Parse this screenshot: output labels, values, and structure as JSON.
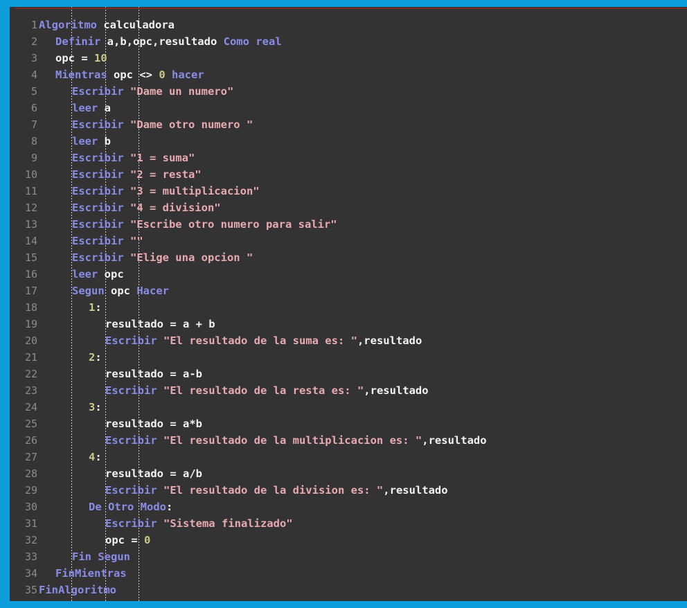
{
  "window": {
    "title": "PSeInt pseudocode editor",
    "frame_color": "#0D9DDB",
    "code_background": "#333333",
    "top_rule_color": "#7E2A2A"
  },
  "palette": {
    "keyword": "#8C8CE8",
    "string": "#E8A9B4",
    "number": "#C9C98A",
    "identifier": "#F2F2F2",
    "gutter": "#8C8C8C",
    "indent_guide": "#C9C9C9"
  },
  "gutter": {
    "line_numbers": [
      "1",
      "2",
      "3",
      "4",
      "5",
      "6",
      "7",
      "8",
      "9",
      "10",
      "11",
      "12",
      "13",
      "14",
      "15",
      "16",
      "17",
      "18",
      "19",
      "20",
      "21",
      "22",
      "23",
      "24",
      "25",
      "26",
      "27",
      "28",
      "29",
      "30",
      "31",
      "32",
      "33",
      "34",
      "35"
    ]
  },
  "indent_guides": [
    103,
    152,
    200
  ],
  "code": {
    "language": "PSeInt",
    "algorithm_name": "calculadora",
    "lines": [
      {
        "n": "1",
        "indent": 0,
        "tokens": [
          {
            "t": "kw",
            "v": "Algoritmo"
          },
          {
            "t": "id",
            "v": " calculadora"
          }
        ]
      },
      {
        "n": "2",
        "indent": 1,
        "tokens": [
          {
            "t": "kw",
            "v": "Definir"
          },
          {
            "t": "id",
            "v": " a,b,opc,resultado "
          },
          {
            "t": "kw",
            "v": "Como real"
          }
        ]
      },
      {
        "n": "3",
        "indent": 1,
        "tokens": [
          {
            "t": "id",
            "v": "opc = "
          },
          {
            "t": "num",
            "v": "10"
          }
        ]
      },
      {
        "n": "4",
        "indent": 1,
        "tokens": [
          {
            "t": "kw",
            "v": "Mientras"
          },
          {
            "t": "id",
            "v": " opc <> "
          },
          {
            "t": "num",
            "v": "0"
          },
          {
            "t": "kw",
            "v": " hacer"
          }
        ]
      },
      {
        "n": "5",
        "indent": 2,
        "tokens": [
          {
            "t": "kw",
            "v": "Escribir"
          },
          {
            "t": "str",
            "v": " \"Dame un numero\""
          }
        ]
      },
      {
        "n": "6",
        "indent": 2,
        "tokens": [
          {
            "t": "kw",
            "v": "leer"
          },
          {
            "t": "id",
            "v": " a"
          }
        ]
      },
      {
        "n": "7",
        "indent": 2,
        "tokens": [
          {
            "t": "kw",
            "v": "Escribir"
          },
          {
            "t": "str",
            "v": " \"Dame otro numero \""
          }
        ]
      },
      {
        "n": "8",
        "indent": 2,
        "tokens": [
          {
            "t": "kw",
            "v": "leer"
          },
          {
            "t": "id",
            "v": " b"
          }
        ]
      },
      {
        "n": "9",
        "indent": 2,
        "tokens": [
          {
            "t": "kw",
            "v": "Escribir"
          },
          {
            "t": "str",
            "v": " \"1 = suma\""
          }
        ]
      },
      {
        "n": "10",
        "indent": 2,
        "tokens": [
          {
            "t": "kw",
            "v": "Escribir"
          },
          {
            "t": "str",
            "v": " \"2 = resta\""
          }
        ]
      },
      {
        "n": "11",
        "indent": 2,
        "tokens": [
          {
            "t": "kw",
            "v": "Escribir"
          },
          {
            "t": "str",
            "v": " \"3 = multiplicacion\""
          }
        ]
      },
      {
        "n": "12",
        "indent": 2,
        "tokens": [
          {
            "t": "kw",
            "v": "Escribir"
          },
          {
            "t": "str",
            "v": " \"4 = division\""
          }
        ]
      },
      {
        "n": "13",
        "indent": 2,
        "tokens": [
          {
            "t": "kw",
            "v": "Escribir"
          },
          {
            "t": "str",
            "v": " \"Escribe otro numero para salir\""
          }
        ]
      },
      {
        "n": "14",
        "indent": 2,
        "tokens": [
          {
            "t": "kw",
            "v": "Escribir"
          },
          {
            "t": "str",
            "v": " \"\""
          }
        ]
      },
      {
        "n": "15",
        "indent": 2,
        "tokens": [
          {
            "t": "kw",
            "v": "Escribir"
          },
          {
            "t": "str",
            "v": " \"Elige una opcion \""
          }
        ]
      },
      {
        "n": "16",
        "indent": 2,
        "tokens": [
          {
            "t": "kw",
            "v": "leer"
          },
          {
            "t": "id",
            "v": " opc"
          }
        ]
      },
      {
        "n": "17",
        "indent": 2,
        "tokens": [
          {
            "t": "kw",
            "v": "Segun"
          },
          {
            "t": "id",
            "v": " opc "
          },
          {
            "t": "kw",
            "v": "Hacer"
          }
        ]
      },
      {
        "n": "18",
        "indent": 3,
        "tokens": [
          {
            "t": "num",
            "v": "1"
          },
          {
            "t": "id",
            "v": ":"
          }
        ]
      },
      {
        "n": "19",
        "indent": 4,
        "tokens": [
          {
            "t": "id",
            "v": "resultado = a + b"
          }
        ]
      },
      {
        "n": "20",
        "indent": 4,
        "tokens": [
          {
            "t": "kw",
            "v": "Escribir"
          },
          {
            "t": "str",
            "v": " \"El resultado de la suma es: \""
          },
          {
            "t": "id",
            "v": ",resultado"
          }
        ]
      },
      {
        "n": "21",
        "indent": 3,
        "tokens": [
          {
            "t": "num",
            "v": "2"
          },
          {
            "t": "id",
            "v": ":"
          }
        ]
      },
      {
        "n": "22",
        "indent": 4,
        "tokens": [
          {
            "t": "id",
            "v": "resultado = a-b"
          }
        ]
      },
      {
        "n": "23",
        "indent": 4,
        "tokens": [
          {
            "t": "kw",
            "v": "Escribir"
          },
          {
            "t": "str",
            "v": " \"El resultado de la resta es: \""
          },
          {
            "t": "id",
            "v": ",resultado"
          }
        ]
      },
      {
        "n": "24",
        "indent": 3,
        "tokens": [
          {
            "t": "num",
            "v": "3"
          },
          {
            "t": "id",
            "v": ":"
          }
        ]
      },
      {
        "n": "25",
        "indent": 4,
        "tokens": [
          {
            "t": "id",
            "v": "resultado = a*b"
          }
        ]
      },
      {
        "n": "26",
        "indent": 4,
        "tokens": [
          {
            "t": "kw",
            "v": "Escribir"
          },
          {
            "t": "str",
            "v": " \"El resultado de la multiplicacion es: \""
          },
          {
            "t": "id",
            "v": ",resultado"
          }
        ]
      },
      {
        "n": "27",
        "indent": 3,
        "tokens": [
          {
            "t": "num",
            "v": "4"
          },
          {
            "t": "id",
            "v": ":"
          }
        ]
      },
      {
        "n": "28",
        "indent": 4,
        "tokens": [
          {
            "t": "id",
            "v": "resultado = a/b"
          }
        ]
      },
      {
        "n": "29",
        "indent": 4,
        "tokens": [
          {
            "t": "kw",
            "v": "Escribir"
          },
          {
            "t": "str",
            "v": " \"El resultado de la division es: \""
          },
          {
            "t": "id",
            "v": ",resultado"
          }
        ]
      },
      {
        "n": "30",
        "indent": 3,
        "tokens": [
          {
            "t": "kw",
            "v": "De Otro Modo"
          },
          {
            "t": "id",
            "v": ":"
          }
        ]
      },
      {
        "n": "31",
        "indent": 4,
        "tokens": [
          {
            "t": "kw",
            "v": "Escribir"
          },
          {
            "t": "str",
            "v": " \"Sistema finalizado\""
          }
        ]
      },
      {
        "n": "32",
        "indent": 4,
        "tokens": [
          {
            "t": "id",
            "v": "opc = "
          },
          {
            "t": "num",
            "v": "0"
          }
        ]
      },
      {
        "n": "33",
        "indent": 2,
        "tokens": [
          {
            "t": "kw",
            "v": "Fin Segun"
          }
        ]
      },
      {
        "n": "34",
        "indent": 1,
        "tokens": [
          {
            "t": "kw",
            "v": "FinMientras"
          }
        ]
      },
      {
        "n": "35",
        "indent": 0,
        "tokens": [
          {
            "t": "kw",
            "v": "FinAlgoritmo"
          }
        ]
      }
    ]
  }
}
